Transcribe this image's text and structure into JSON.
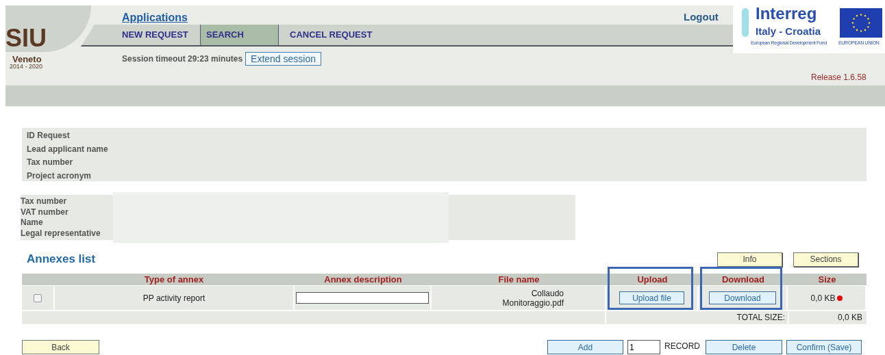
{
  "logo": {
    "name": "SIU",
    "region": "Veneto",
    "years": "2014 - 2020"
  },
  "header": {
    "applications_link": "Applications",
    "logout": "Logout",
    "release": "Release 1.6.58"
  },
  "partner_logo": {
    "title": "Interreg",
    "subtitle": "Italy - Croatia",
    "fund": "European Regional Development Fund",
    "union": "EUROPEAN UNION"
  },
  "tabs": [
    {
      "label": "NEW REQUEST",
      "selected": false
    },
    {
      "label": "SEARCH",
      "selected": true
    },
    {
      "label": "CANCEL REQUEST",
      "selected": false
    }
  ],
  "session": {
    "text": "Session timeout 29:23 minutes",
    "button": "Extend session"
  },
  "request_panel": {
    "labels": [
      "ID Request",
      "Lead applicant name",
      "Tax number",
      "Project acronym"
    ]
  },
  "partner_panel": {
    "labels": [
      "Tax number",
      "VAT number",
      "Name",
      "Legal representative"
    ]
  },
  "annexes": {
    "title": "Annexes list",
    "buttons": [
      "Info",
      "Sections"
    ],
    "columns": [
      {
        "label": "Type of annex",
        "highlighted": false
      },
      {
        "label": "Annex description",
        "highlighted": false
      },
      {
        "label": "File name",
        "highlighted": false
      },
      {
        "label": "Upload",
        "highlighted": true
      },
      {
        "label": "Download",
        "highlighted": true
      },
      {
        "label": "Size",
        "highlighted": false
      }
    ],
    "rows": [
      {
        "checked": false,
        "type": "PP activity report",
        "file_name": "Collaudo Monitoraggio.pdf",
        "upload": "Upload file",
        "download": "Download",
        "size": "0,0 KB",
        "color": "#e01010"
      }
    ],
    "total_label": "TOTAL SIZE:",
    "total_value": "0,0 KB"
  },
  "footer": {
    "back": "Back",
    "add": "Add",
    "record_count": "1",
    "record_label": "RECORD",
    "delete": "Delete",
    "confirm": "Confirm (Save)"
  }
}
